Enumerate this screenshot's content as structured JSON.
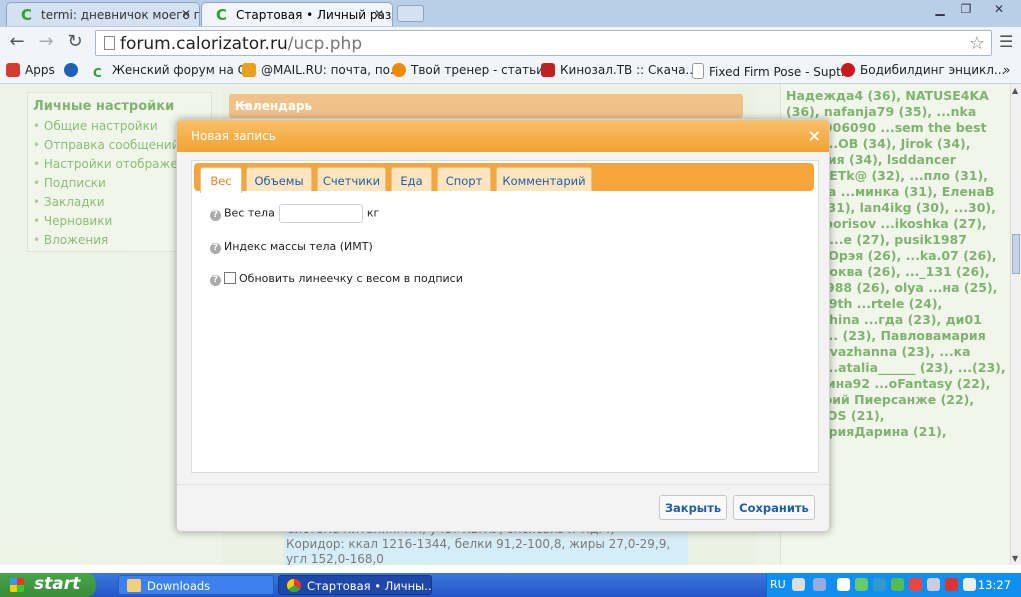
{
  "browser": {
    "tabs": [
      {
        "title": "termi: дневничок моего по"
      },
      {
        "title": "Стартовая • Личный разде"
      }
    ],
    "url_host": "forum.calorizator.ru",
    "url_path": "/ucp.php",
    "bookmarks": [
      {
        "label": "Apps",
        "color": "#d83a2e"
      },
      {
        "label": "",
        "color": "#1e62b8"
      },
      {
        "label": "Женский форум на С...",
        "color": "#2ea12e"
      },
      {
        "label": "@MAIL.RU: почта, по...",
        "color": "#e8a21a"
      },
      {
        "label": "Твой тренер - статьи...",
        "color": "#f08a00"
      },
      {
        "label": "Кинозал.ТВ :: Скача...",
        "color": "#c02020"
      },
      {
        "label": "Fixed Firm Pose - Supt...",
        "color": "#dddddd"
      },
      {
        "label": "Бодибилдинг энцикл...",
        "color": "#cc1a1a"
      }
    ]
  },
  "page": {
    "settings_title": "Личные настройки",
    "settings_items": [
      "Общие настройки",
      "Отправка сообщений",
      "Настройки отображени",
      "Подписки",
      "Закладки",
      "Черновики",
      "Вложения"
    ],
    "calendar_title": "Календарь",
    "signature_lines": [
      "Система питания: ПП, учет КБЖУ, оксисайз и т.д. :)",
      "Коридор: ккал 1216-1344, белки 91,2-100,8, жиры 27,0-29,9, угл 152,0-168,0"
    ],
    "users_text": "Надежда4 (36), NATUSE4KA (36), nafanja79 (35), ...nka (35), 906090 ...sem the best (35), ...ОВ (34), Jirok (34), ...мария (34), lsddancer ...RuNETk@ (32), ...пло (31), sini4ka ...минка (31), ЕленаВ ...7а (31), lan4ikg (30), ...30), denisborisov ...ikoshka (27), Sama ...е (27), pusik1987 ...атя Орэя (26), ...ka.07 (26), ..._Клюква (26), ..._131 (26), ...на1988 (26), olya ...на (25), Alice19th ...rtele (24), Suhushina ...гда (23), ди01 (23), ... (23), Павловамария ...avlovazhanna (23), ...ка (23), ...atalia______ (23), ...(23), кристина92 ...oFantasy (22), Дмитрий Пиерсанже (22), JuliaDOS (21), ВикторияДарина (21),"
  },
  "modal": {
    "title": "Новая запись",
    "tabs": [
      "Вес",
      "Объемы",
      "Счетчики",
      "Еда",
      "Спорт",
      "Комментарий"
    ],
    "active_tab": "Вес",
    "weight_label": "Вес тела",
    "weight_value": "",
    "weight_unit": "кг",
    "bmi_label": "Индекс массы тела (ИМТ)",
    "update_label": "Обновить линеечку с весом в подписи",
    "update_checked": false,
    "help_glyph": "?",
    "close_button": "Закрыть",
    "save_button": "Сохранить"
  },
  "taskbar": {
    "start_label": "start",
    "items": [
      {
        "label": "Downloads"
      },
      {
        "label": "Стартовая • Личны..."
      }
    ],
    "language": "RU",
    "clock": "13:27"
  }
}
